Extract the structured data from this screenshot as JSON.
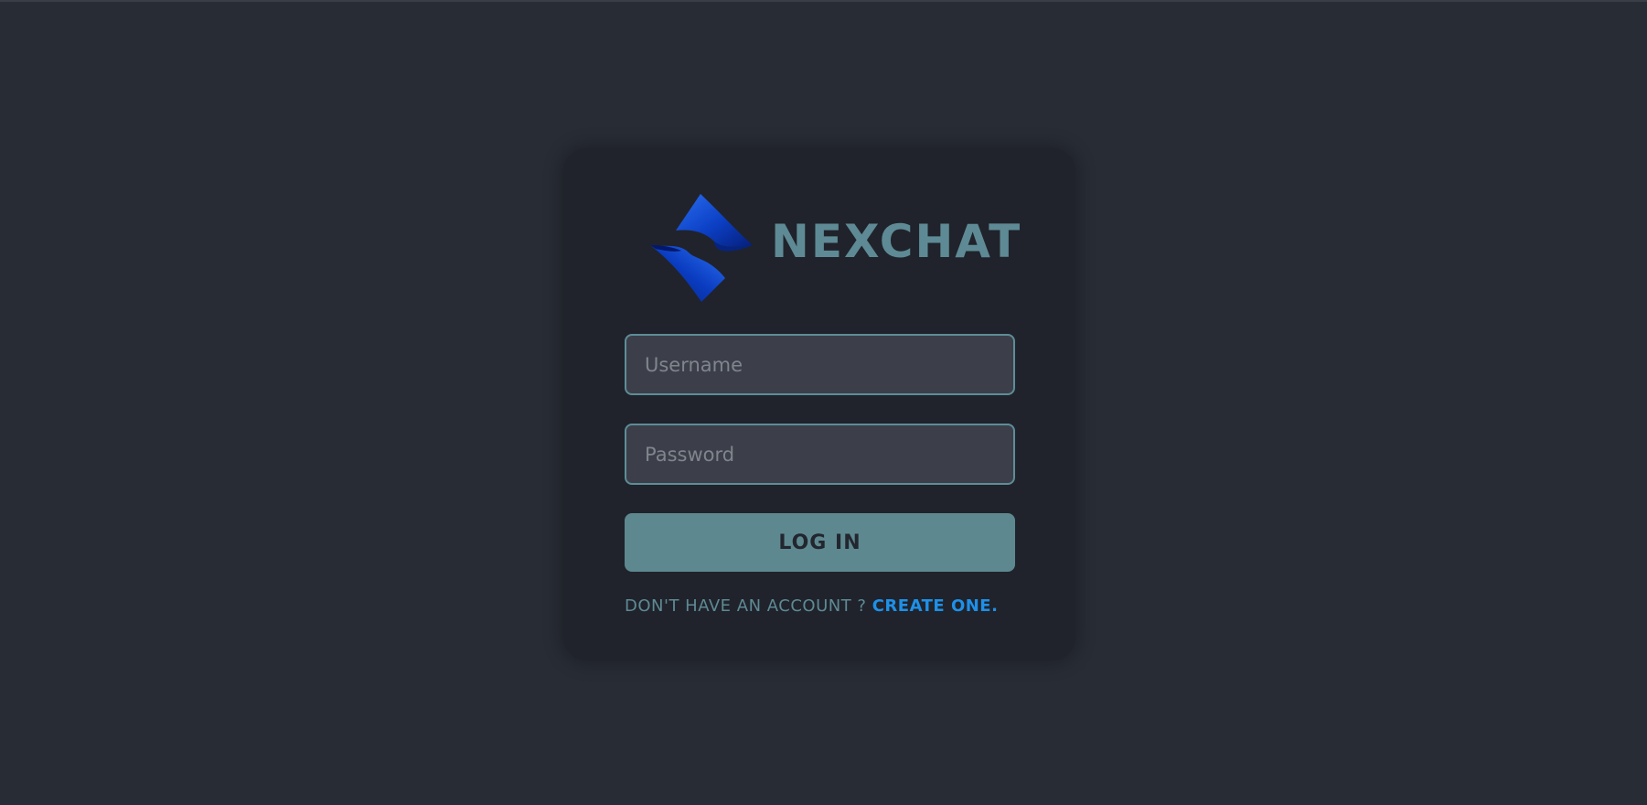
{
  "app": {
    "name": "NEXCHAT"
  },
  "login": {
    "username_placeholder": "Username",
    "password_placeholder": "Password",
    "login_label": "LOG IN",
    "signup_prompt": "DON'T HAVE AN ACCOUNT ? ",
    "signup_link": "CREATE ONE."
  },
  "icons": {
    "logo": "nexchat-logo-icon"
  },
  "colors": {
    "background": "#282c35",
    "card": "#20232b",
    "accent": "#5e8a95",
    "link": "#1e90e8",
    "logo_blue": "#0a3fc7"
  }
}
